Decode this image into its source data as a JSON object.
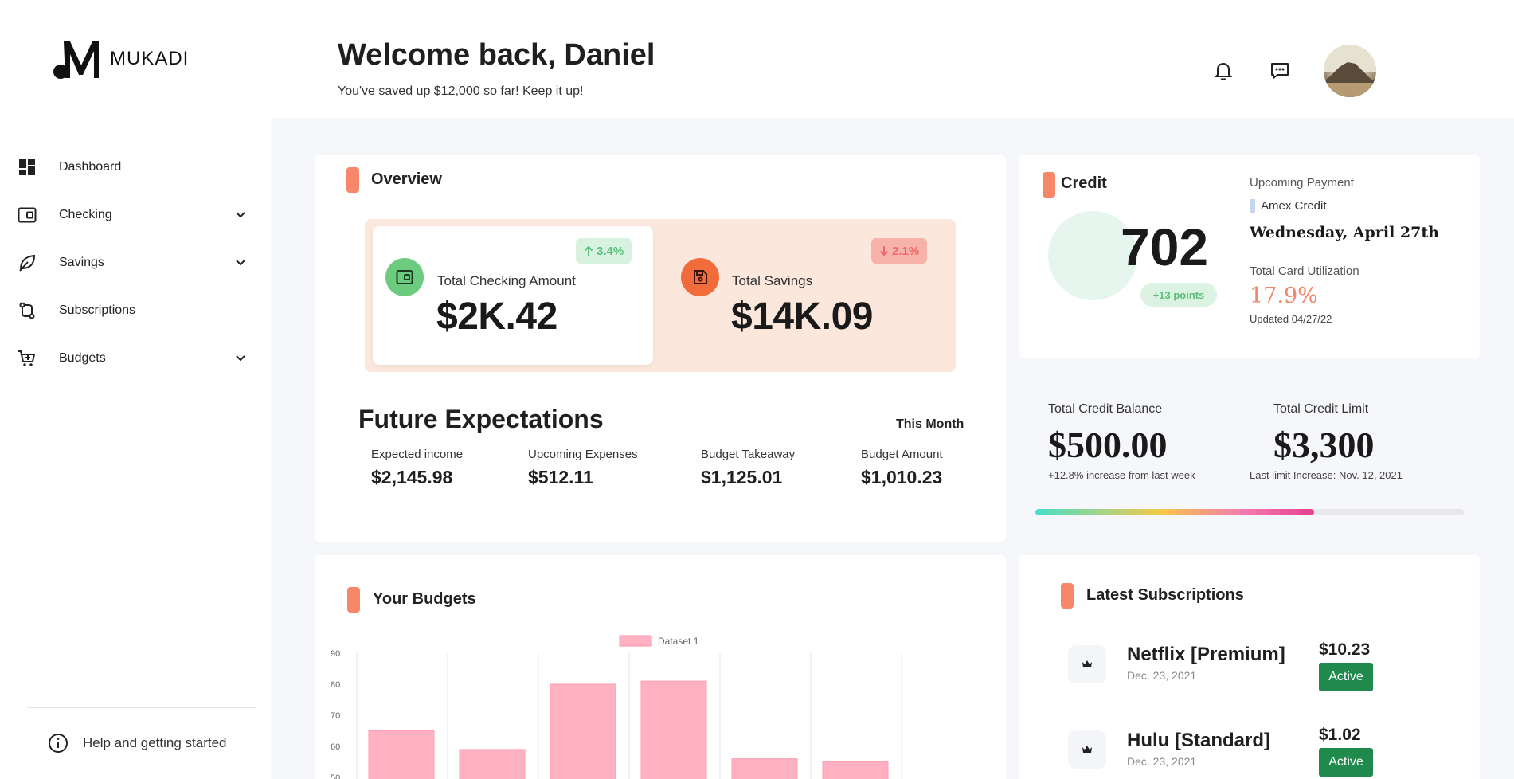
{
  "brand": {
    "name": "MUKADI"
  },
  "sidebar": {
    "items": [
      {
        "label": "Dashboard",
        "icon": "dashboard-icon",
        "has_chevron": false
      },
      {
        "label": "Checking",
        "icon": "wallet-icon",
        "has_chevron": true
      },
      {
        "label": "Savings",
        "icon": "leaf-icon",
        "has_chevron": true
      },
      {
        "label": "Subscriptions",
        "icon": "swap-icon",
        "has_chevron": false
      },
      {
        "label": "Budgets",
        "icon": "cart-icon",
        "has_chevron": true
      }
    ],
    "help_label": "Help and getting started"
  },
  "header": {
    "title": "Welcome back, Daniel",
    "subtitle": "You've saved up $12,000 so far! Keep it up!"
  },
  "overview": {
    "title": "Overview",
    "checking": {
      "label": "Total Checking Amount",
      "value": "$2K.42",
      "change": "3.4%",
      "direction": "up"
    },
    "savings": {
      "label": "Total Savings",
      "value": "$14K.09",
      "change": "2.1%",
      "direction": "down"
    }
  },
  "future": {
    "title": "Future Expectations",
    "period": "This Month",
    "items": [
      {
        "label": "Expected income",
        "value": "$2,145.98"
      },
      {
        "label": "Upcoming Expenses",
        "value": "$512.11"
      },
      {
        "label": "Budget Takeaway",
        "value": "$1,125.01"
      },
      {
        "label": "Budget Amount",
        "value": "$1,010.23"
      }
    ]
  },
  "credit": {
    "title": "Credit",
    "score": "702",
    "points": "+13 points",
    "upcoming_label": "Upcoming Payment",
    "upcoming_card": "Amex Credit",
    "upcoming_date": "Wednesday, April 27th",
    "utilization_label": "Total Card Utilization",
    "utilization_value": "17.9%",
    "updated": "Updated 04/27/22",
    "balance_label": "Total Credit Balance",
    "balance_value": "$500.00",
    "balance_note": "+12.8% increase from last week",
    "limit_label": "Total Credit Limit",
    "limit_value": "$3,300",
    "limit_note": "Last limit Increase: Nov. 12, 2021",
    "utilization_fraction": 0.65
  },
  "budgets": {
    "title": "Your Budgets"
  },
  "chart_data": {
    "type": "bar",
    "series": [
      {
        "name": "Dataset 1",
        "values": [
          65,
          59,
          80,
          81,
          56,
          55
        ],
        "color": "#ffb1c1"
      }
    ],
    "y_ticks": [
      50,
      60,
      70,
      80,
      90
    ],
    "ylim": [
      40,
      90
    ],
    "legend": "top-center",
    "grid": true
  },
  "subscriptions": {
    "title": "Latest Subscriptions",
    "items": [
      {
        "name": "Netflix [Premium]",
        "date": "Dec. 23, 2021",
        "price": "$10.23",
        "status": "Active"
      },
      {
        "name": "Hulu [Standard]",
        "date": "Dec. 23, 2021",
        "price": "$1.02",
        "status": "Active"
      }
    ]
  },
  "colors": {
    "accent": "#f8876a",
    "up_green": "#5bbf7a",
    "down_red": "#f0666a",
    "active_green": "#1f8a4c",
    "utilization": "#f0866a"
  }
}
